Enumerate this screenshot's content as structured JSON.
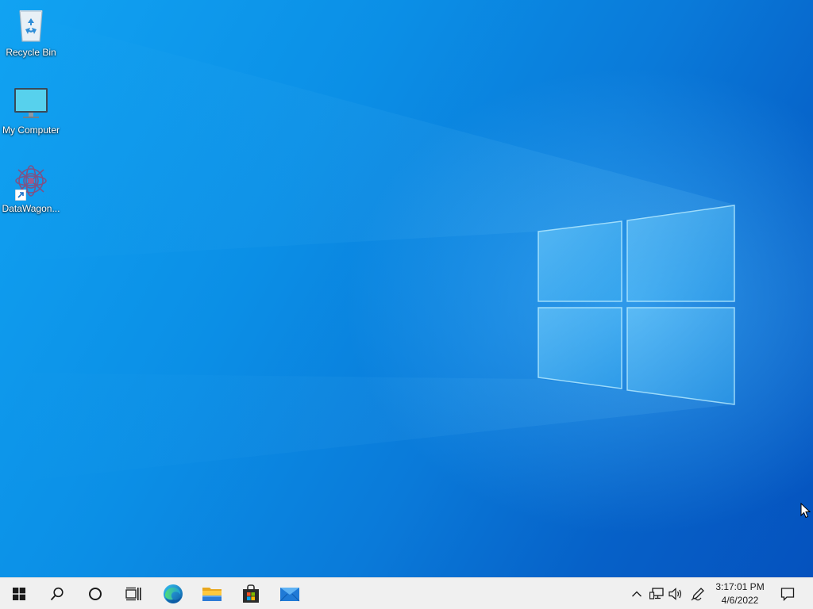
{
  "desktop": {
    "icons": [
      {
        "label": "Recycle Bin",
        "icon": "recycle-bin-icon"
      },
      {
        "label": "My Computer",
        "icon": "computer-monitor-icon"
      },
      {
        "label": "DataWagon...",
        "icon": "datawagon-app-icon",
        "shortcut": true
      }
    ]
  },
  "taskbar": {
    "buttons": [
      {
        "name": "start",
        "icon": "windows-logo-icon"
      },
      {
        "name": "search",
        "icon": "search-icon"
      },
      {
        "name": "cortana",
        "icon": "cortana-circle-icon"
      },
      {
        "name": "task-view",
        "icon": "task-view-icon"
      },
      {
        "name": "edge",
        "icon": "edge-browser-icon"
      },
      {
        "name": "file-explorer",
        "icon": "folder-icon"
      },
      {
        "name": "store",
        "icon": "store-bag-icon"
      },
      {
        "name": "mail",
        "icon": "mail-envelope-icon"
      }
    ],
    "tray": [
      {
        "name": "show-hidden",
        "icon": "chevron-up-icon"
      },
      {
        "name": "network",
        "icon": "network-icon"
      },
      {
        "name": "volume",
        "icon": "speaker-icon"
      },
      {
        "name": "pen",
        "icon": "pen-icon"
      }
    ],
    "clock": {
      "time": "3:17:01 PM",
      "date": "4/6/2022"
    },
    "notifications": {
      "icon": "action-center-icon"
    }
  },
  "colors": {
    "wallpaper_blue": "#0a84e0",
    "taskbar_bg": "#f0f0f0",
    "icon_text": "#ffffff"
  }
}
